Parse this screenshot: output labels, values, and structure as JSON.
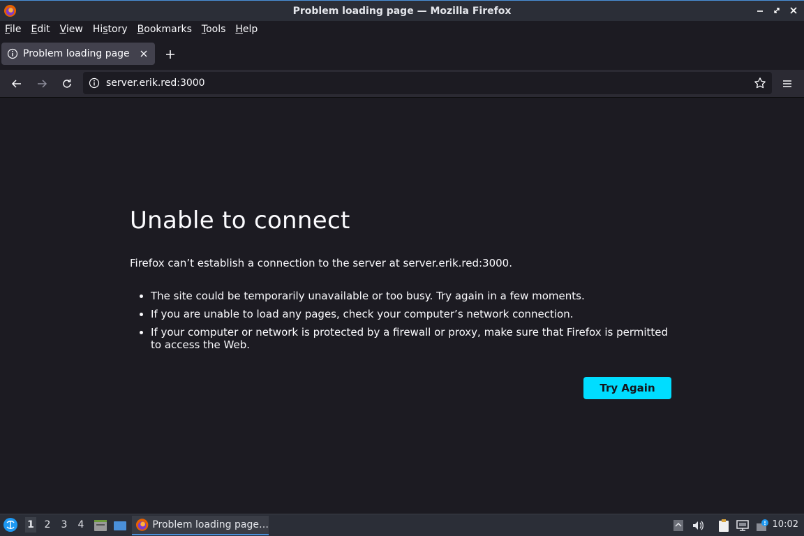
{
  "window": {
    "title": "Problem loading page — Mozilla Firefox"
  },
  "menu": {
    "items": [
      {
        "label": "File",
        "mnemonic": "F",
        "rest": "ile"
      },
      {
        "label": "Edit",
        "mnemonic": "E",
        "rest": "dit"
      },
      {
        "label": "View",
        "mnemonic": "V",
        "rest": "iew"
      },
      {
        "label": "History",
        "pre": "Hi",
        "mnemonic": "s",
        "rest": "tory"
      },
      {
        "label": "Bookmarks",
        "mnemonic": "B",
        "rest": "ookmarks"
      },
      {
        "label": "Tools",
        "mnemonic": "T",
        "rest": "ools"
      },
      {
        "label": "Help",
        "mnemonic": "H",
        "rest": "elp"
      }
    ]
  },
  "tabs": [
    {
      "label": "Problem loading page",
      "active": true
    }
  ],
  "navbar": {
    "url": "server.erik.red:3000"
  },
  "error": {
    "title": "Unable to connect",
    "description": "Firefox can’t establish a connection to the server at server.erik.red:3000.",
    "bullets": [
      "The site could be temporarily unavailable or too busy. Try again in a few moments.",
      "If you are unable to load any pages, check your computer’s network connection.",
      "If your computer or network is protected by a firewall or proxy, make sure that Firefox is permitted to access the Web."
    ],
    "button_label": "Try Again"
  },
  "taskbar": {
    "workspaces": [
      "1",
      "2",
      "3",
      "4"
    ],
    "active_workspace": "1",
    "task_label": "Problem loading page…",
    "clock": "10:02"
  },
  "colors": {
    "accent": "#00ddff",
    "page_bg": "#1c1b22",
    "toolbar_bg": "#2b2a33",
    "tab_active_bg": "#42414d",
    "panel_bg": "#2b2e37"
  }
}
